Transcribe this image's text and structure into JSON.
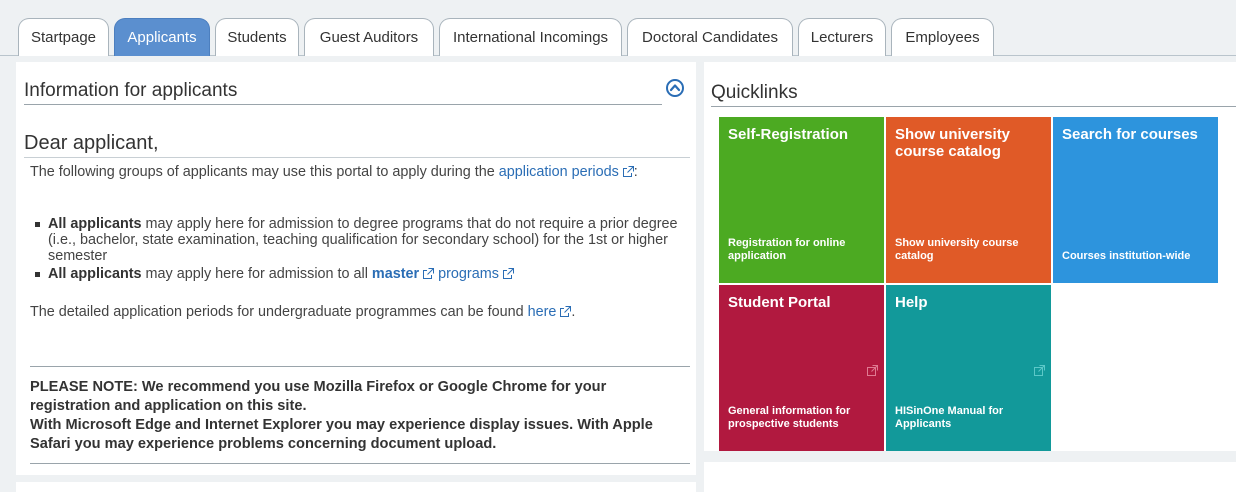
{
  "tabs": [
    {
      "label": "Startpage",
      "active": false
    },
    {
      "label": "Applicants",
      "active": true
    },
    {
      "label": "Students",
      "active": false
    },
    {
      "label": "Guest Auditors",
      "active": false
    },
    {
      "label": "International Incomings",
      "active": false
    },
    {
      "label": "Doctoral Candidates",
      "active": false
    },
    {
      "label": "Lecturers",
      "active": false
    },
    {
      "label": "Employees",
      "active": false
    }
  ],
  "info": {
    "title": "Information for applicants",
    "heading": "Dear applicant,",
    "intro_text": "The following groups of applicants may use this portal to apply during the ",
    "intro_link": "application periods",
    "intro_colon": ":",
    "bullet1_bold": "All applicants",
    "bullet1_text": " may apply here for admission to degree programs that do not require a prior degree (i.e., bachelor, state examination, teaching qualification for secondary school) for the 1st or higher semester",
    "bullet2_bold": "All applicants",
    "bullet2_text": " may apply here for admission to all ",
    "bullet2_link1": "master",
    "bullet2_link2": "programs",
    "detail_text": "The detailed application periods for undergraduate programmes can be found ",
    "detail_link": "here",
    "detail_end": ".",
    "note_line1": "PLEASE NOTE: We recommend you use Mozilla Firefox or Google Chrome for your registration and application on this site.",
    "note_line2": "With Microsoft Edge and Internet Explorer you may experience display issues. With Apple Safari you may experience problems concerning document upload."
  },
  "quicklinks": {
    "title": "Quicklinks",
    "tiles": [
      {
        "title": "Self-Registration",
        "subtitle": "Registration for online application",
        "color": "#4caa22",
        "external": false
      },
      {
        "title": "Show university course catalog",
        "subtitle": "Show university course catalog",
        "color": "#e05a27",
        "external": false
      },
      {
        "title": "Search for courses",
        "subtitle": "Courses institution-wide",
        "color": "#2d94dd",
        "external": false
      },
      {
        "title": "Student Portal",
        "subtitle": "General information for prospective students",
        "color": "#b1193f",
        "external": true
      },
      {
        "title": "Help",
        "subtitle": "HISinOne Manual for Applicants",
        "color": "#12999a",
        "external": true
      }
    ]
  },
  "colors": {
    "active_tab": "#5b8fcf",
    "link": "#2a6db5"
  }
}
